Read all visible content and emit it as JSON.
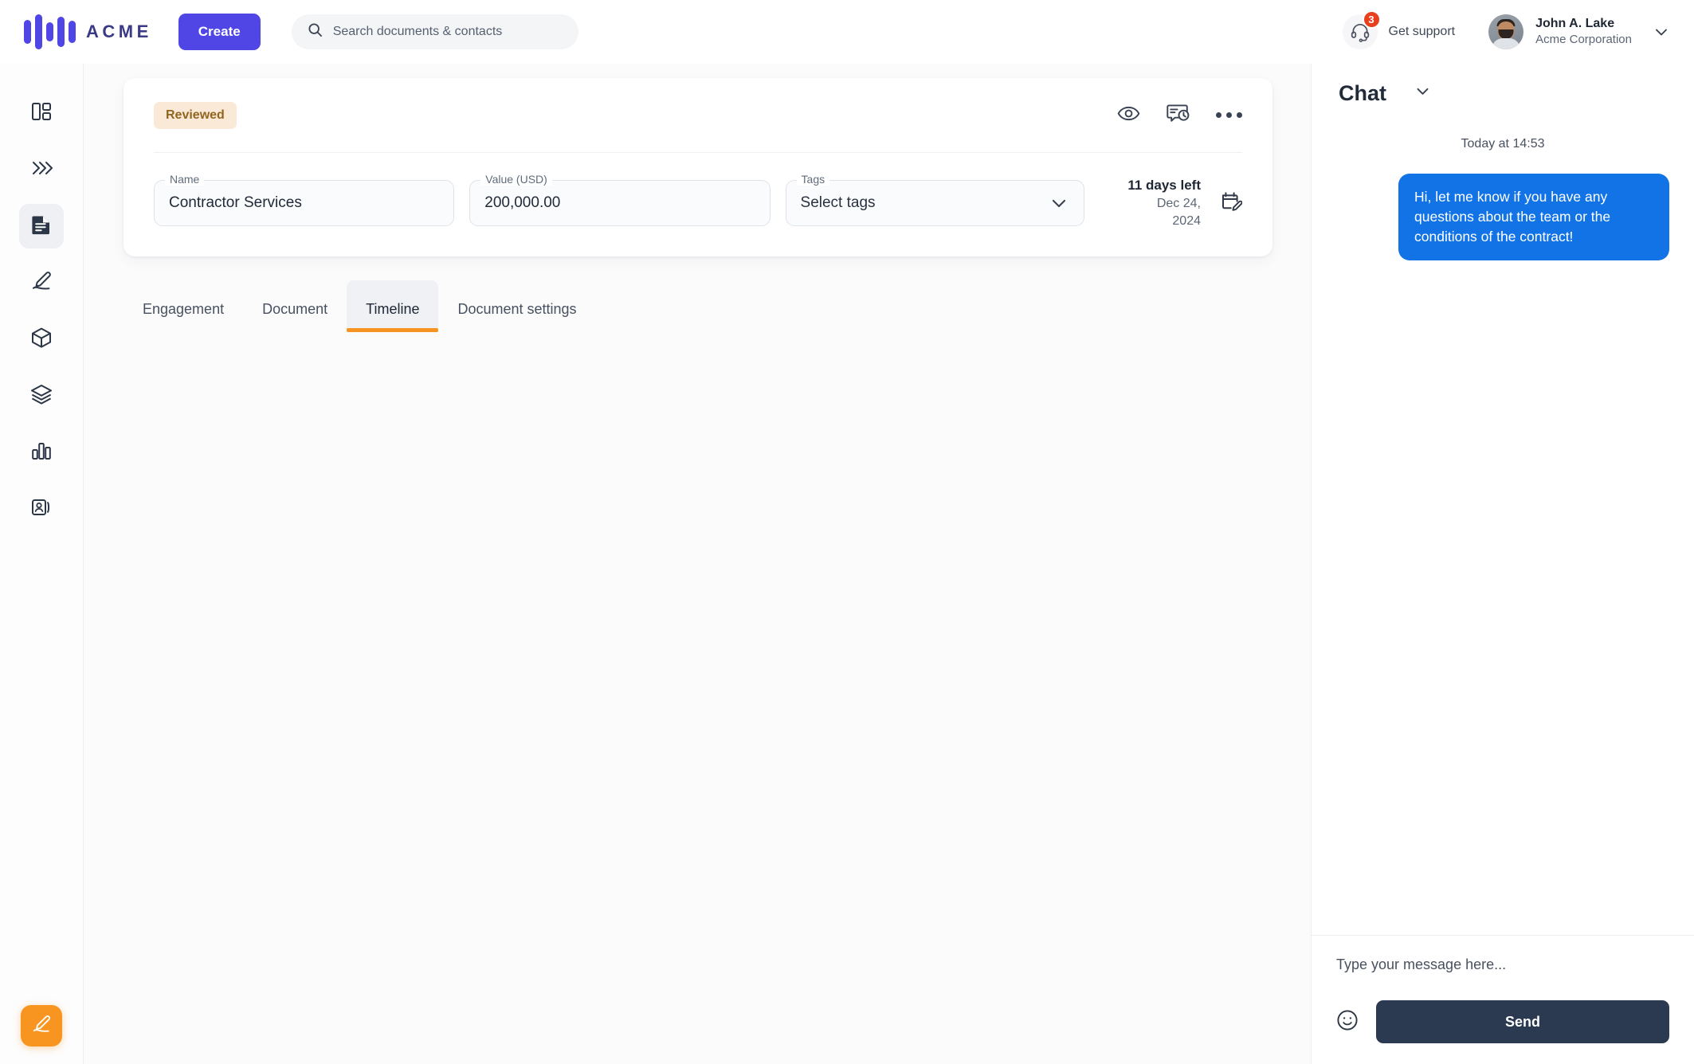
{
  "topbar": {
    "logo_text": "ACME",
    "create_label": "Create",
    "search_placeholder": "Search documents & contacts",
    "support_label": "Get support",
    "support_badge": "3",
    "profile_name": "John A. Lake",
    "profile_org": "Acme Corporation"
  },
  "rail": {
    "items": [
      {
        "icon": "dashboard-icon",
        "label": "Dashboard"
      },
      {
        "icon": "chevrons-icon",
        "label": "Workflows"
      },
      {
        "icon": "document-icon",
        "label": "Documents"
      },
      {
        "icon": "signature-icon",
        "label": "Signatures"
      },
      {
        "icon": "cube-icon",
        "label": "Assets"
      },
      {
        "icon": "layers-icon",
        "label": "Templates"
      },
      {
        "icon": "bar-chart-icon",
        "label": "Reports"
      },
      {
        "icon": "contacts-icon",
        "label": "Contacts"
      }
    ],
    "fab_icon": "signature-pen-icon"
  },
  "document": {
    "status_badge": "Reviewed",
    "actions": [
      {
        "icon": "eye-icon",
        "label": "Preview"
      },
      {
        "icon": "comment-history-icon",
        "label": "History"
      },
      {
        "icon": "more-icon",
        "label": "More"
      }
    ],
    "fields": {
      "name_label": "Name",
      "name_value": "Contractor Services",
      "value_label": "Value (USD)",
      "value_value": "200,000.00",
      "tags_label": "Tags",
      "tags_value": "Select tags"
    },
    "due": {
      "days_left": "11 days left",
      "date": "Dec 24, 2024"
    },
    "tabs": [
      {
        "label": "Engagement",
        "active": false
      },
      {
        "label": "Document",
        "active": false
      },
      {
        "label": "Timeline",
        "active": true
      },
      {
        "label": "Document settings",
        "active": false
      }
    ]
  },
  "chat": {
    "title": "Chat",
    "timestamp": "Today at 14:53",
    "messages": [
      {
        "text": "Hi, let me know if you have any questions about the team or the conditions of the contract!",
        "side": "right"
      }
    ],
    "input_placeholder": "Type your message here...",
    "send_label": "Send"
  },
  "colors": {
    "brand_purple": "#5046e5",
    "accent_orange": "#f59421",
    "chat_blue": "#1173e6",
    "send_navy": "#2b3a50",
    "badge_red": "#e8401f",
    "status_bg": "#fbe9d7",
    "status_fg": "#92651f"
  }
}
